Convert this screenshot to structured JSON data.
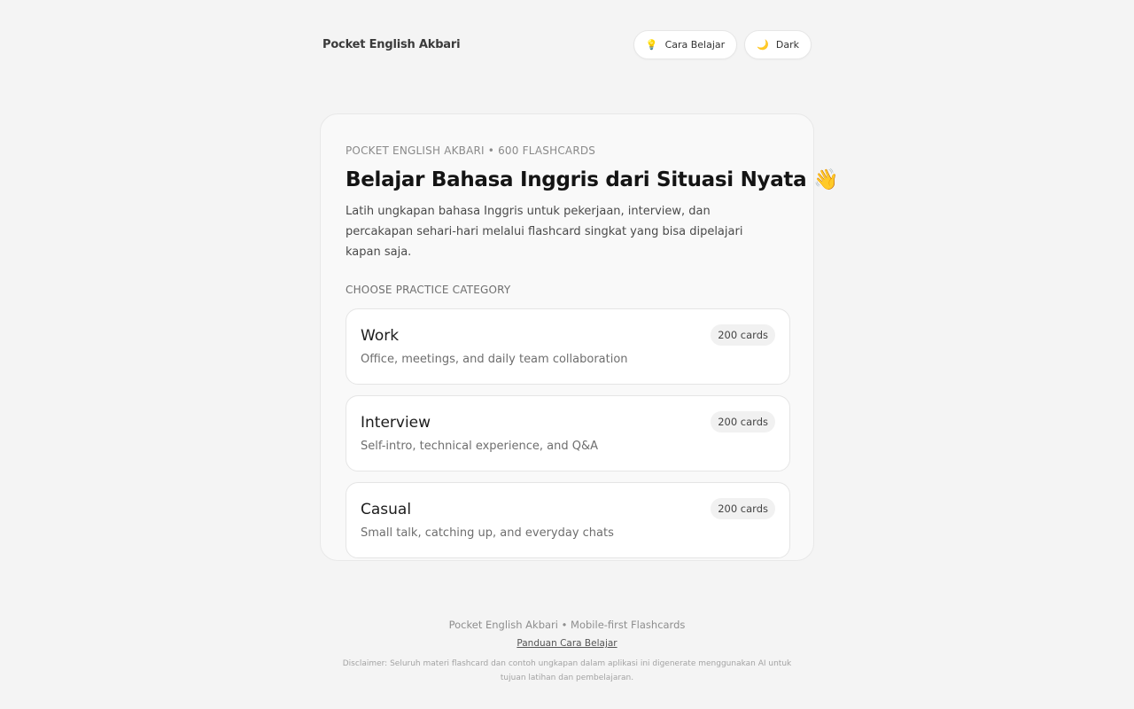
{
  "header": {
    "brand": "Pocket English Akbari",
    "guide_button": {
      "label": "Cara Belajar",
      "icon": "lightbulb-icon",
      "glyph": "💡"
    },
    "theme_button": {
      "label": "Dark",
      "icon": "moon-icon",
      "glyph": "🌙"
    }
  },
  "hero": {
    "eyebrow": "POCKET ENGLISH AKBARI • 600 FLASHCARDS",
    "title": "Belajar Bahasa Inggris dari Situasi Nyata",
    "title_emoji": "👋",
    "description": "Latih ungkapan bahasa Inggris untuk pekerjaan, interview, dan percakapan sehari-hari melalui flashcard singkat yang bisa dipelajari kapan saja.",
    "section_label": "CHOOSE PRACTICE CATEGORY"
  },
  "categories": [
    {
      "name": "Work",
      "subtitle": "Office, meetings, and daily team collaboration",
      "badge": "200 cards"
    },
    {
      "name": "Interview",
      "subtitle": "Self-intro, technical experience, and Q&A",
      "badge": "200 cards"
    },
    {
      "name": "Casual",
      "subtitle": "Small talk, catching up, and everyday chats",
      "badge": "200 cards"
    }
  ],
  "footer": {
    "tagline": "Pocket English Akbari • Mobile-first Flashcards",
    "guide_link": "Panduan Cara Belajar",
    "disclaimer": "Disclaimer: Seluruh materi flashcard dan contoh ungkapan dalam aplikasi ini digenerate menggunakan AI untuk tujuan latihan dan pembelajaran."
  },
  "colors": {
    "background": "#f4f4f4",
    "card": "#f9f9f9",
    "surface": "#ffffff",
    "accent_icon": "#e0a800"
  }
}
